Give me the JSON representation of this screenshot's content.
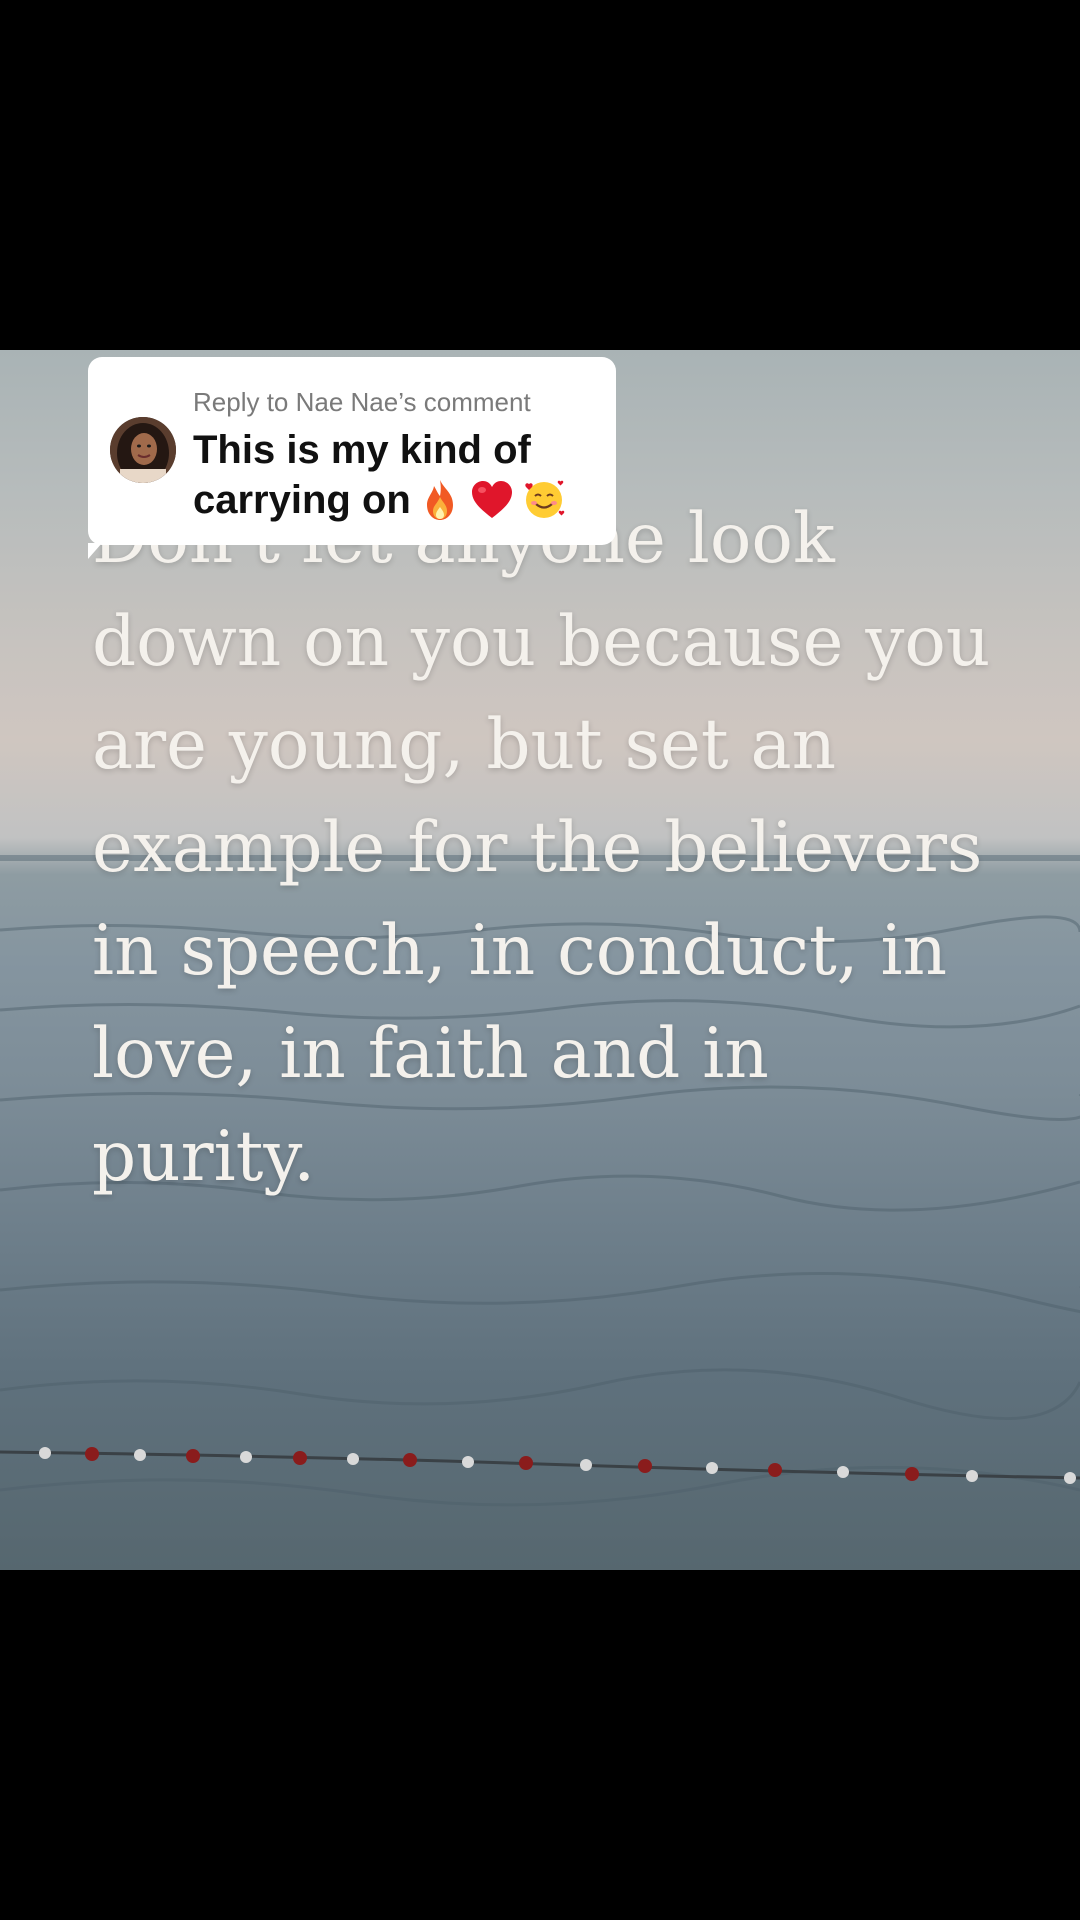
{
  "reply": {
    "label": "Reply to Nae Nae’s comment",
    "comment_line1": "This is my kind of",
    "comment_line2": "carrying on",
    "emojis": [
      "fire-emoji",
      "red-heart-emoji",
      "smiling-face-with-hearts-emoji"
    ]
  },
  "video": {
    "quote_line1": "Don't let anyone look",
    "quote_line2": "down on you because you",
    "quote_line3": "are young, but set an",
    "quote_line4": "example for the believers",
    "quote_line5": "in speech, in conduct, in",
    "quote_line6": "love, in faith and in",
    "quote_line7": "purity."
  },
  "colors": {
    "background": "#000000",
    "bubble": "#ffffff",
    "quote_text": "#f4f1ec",
    "reply_label": "#7a7a7a"
  }
}
